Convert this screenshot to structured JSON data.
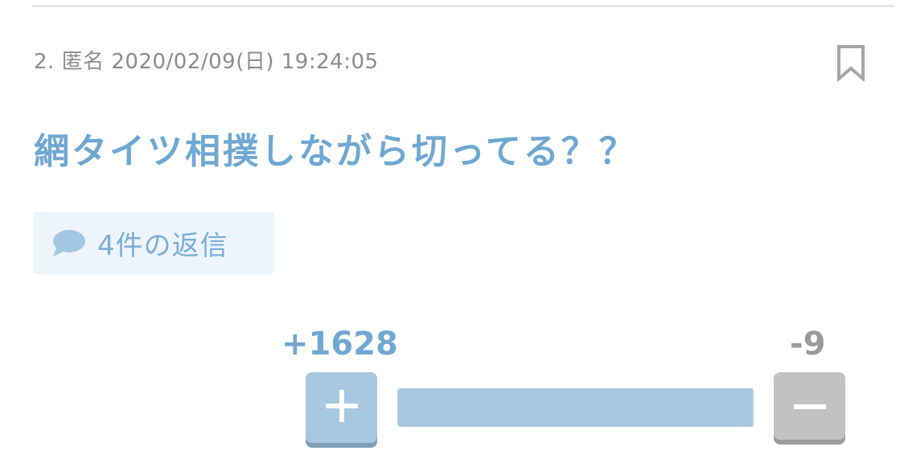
{
  "comment": {
    "number": "2.",
    "author": "匿名",
    "datetime": "2020/02/09(日) 19:24:05",
    "text": "網タイツ相撲しながら切ってる？？",
    "replies_label": "4件の返信"
  },
  "votes": {
    "plus_label": "+1628",
    "minus_label": "-9",
    "plus_count": 1628,
    "minus_count": 9
  },
  "icons": {
    "bookmark": "bookmark-icon",
    "reply": "speech-bubble-icon",
    "plus": "plus-icon",
    "minus": "minus-icon"
  },
  "colors": {
    "accent": "#6fa8d2",
    "plus_button": "#a8c7e0",
    "minus_button": "#c2c2c2",
    "meta_text": "#8c8c8c",
    "reply_bg": "#edf4fb"
  }
}
